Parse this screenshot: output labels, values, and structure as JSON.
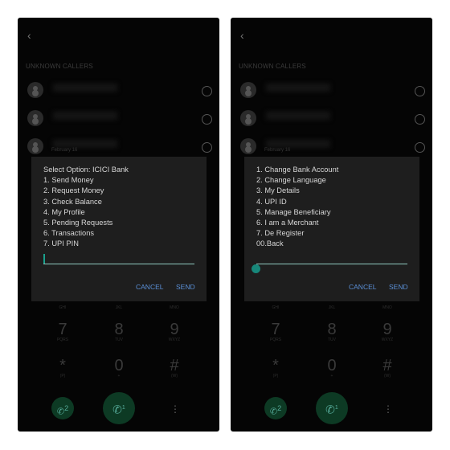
{
  "phones": [
    {
      "header": {
        "back_icon": "chevron-left-icon",
        "section": "UNKNOWN CALLERS"
      },
      "recent": [
        {
          "date": ""
        },
        {
          "date": ""
        },
        {
          "date": "February 16"
        }
      ],
      "dialog": {
        "lines": [
          "Select Option: ICICI Bank",
          "1. Send Money",
          "2. Request Money",
          "3. Check Balance",
          "4. My Profile",
          "5. Pending Requests",
          "6. Transactions",
          "7. UPI PIN"
        ],
        "input_value": "",
        "cancel": "CANCEL",
        "send": "SEND"
      }
    },
    {
      "header": {
        "back_icon": "chevron-left-icon",
        "section": "UNKNOWN CALLERS"
      },
      "recent": [
        {
          "date": ""
        },
        {
          "date": ""
        },
        {
          "date": "February 16"
        }
      ],
      "dialog": {
        "lines": [
          "1. Change Bank Account",
          "2. Change Language",
          "3. My Details",
          "4. UPI ID",
          "5. Manage Beneficiary",
          "6. I am a Merchant",
          "7. De Register",
          "00.Back"
        ],
        "input_value": "",
        "cancel": "CANCEL",
        "send": "SEND"
      }
    }
  ],
  "keypad": {
    "top_letters": [
      "GHI",
      "JKL",
      "MNO"
    ],
    "keys": [
      {
        "d": "7",
        "l": "PQRS"
      },
      {
        "d": "8",
        "l": "TUV"
      },
      {
        "d": "9",
        "l": "WXYZ"
      },
      {
        "d": "*",
        "l": "(P)"
      },
      {
        "d": "0",
        "l": "+"
      },
      {
        "d": "#",
        "l": "(W)"
      }
    ],
    "sim2": "2",
    "sim1": "1",
    "more_icon": "more-vertical-icon"
  },
  "colors": {
    "accent": "#5a8fd6",
    "cursor": "#17877a",
    "call": "#0d3a24"
  }
}
